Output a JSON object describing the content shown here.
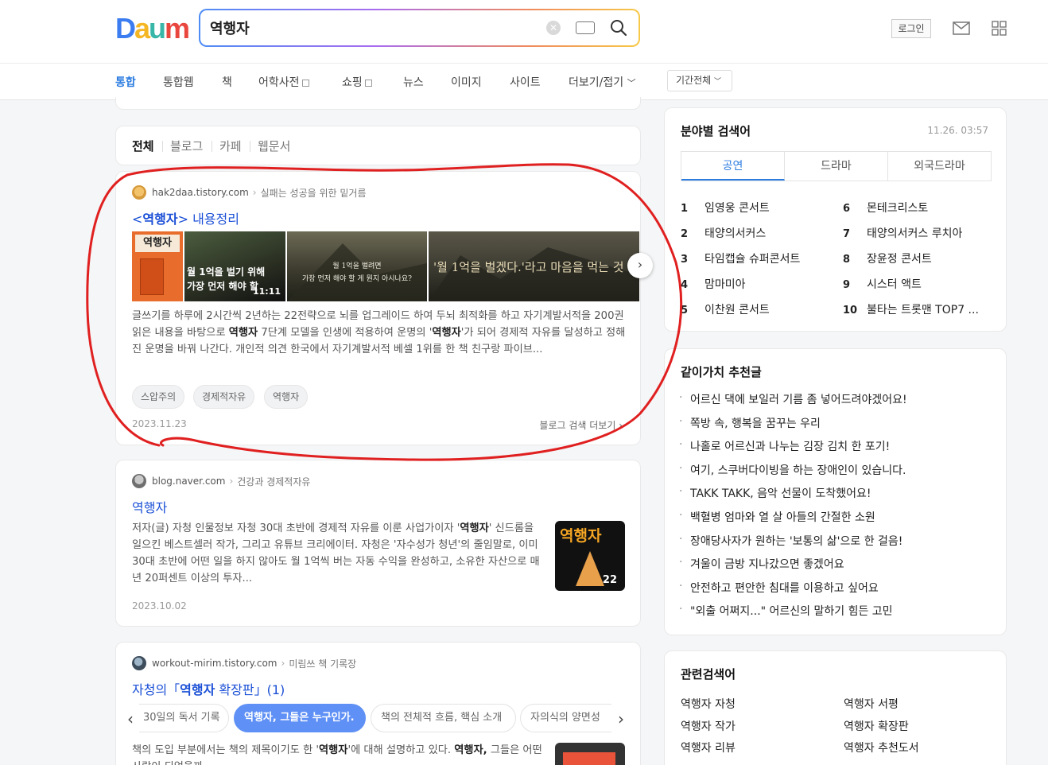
{
  "header": {
    "logo": "Daum",
    "search_value": "역행자",
    "login_label": "로그인"
  },
  "nav": {
    "items": [
      "통합",
      "통합웹",
      "책",
      "어학사전",
      "쇼핑",
      "뉴스",
      "이미지",
      "사이트",
      "더보기/접기"
    ],
    "period": "기간전체"
  },
  "filter_tabs": [
    "전체",
    "블로그",
    "카페",
    "웹문서"
  ],
  "results": [
    {
      "domain": "hak2daa.tistory.com",
      "blog_name": "실패는 성공을 위한 밑거름",
      "title_pre": "<",
      "title_em": "역행자",
      "title_post": "> 내용정리",
      "thumbs": [
        {
          "text": "역행자"
        },
        {
          "text1": "월 1억을 벌기 위해",
          "text2": "가장 먼저 해야 할",
          "duration": "11:11"
        },
        {
          "text1": "월 1억을 벌려면",
          "text2": "가장 먼저 해야 할 게 뭔지 아시나요?"
        },
        {
          "text1": "'월 1억을 벌겠다.'라고 마음을 먹는 것"
        }
      ],
      "snippet_1": "글쓰기를 하루에 2시간씩 2년하는 22전략으로 뇌를 업그레이드 하여 두뇌 최적화를 하고 자기계발서적을 200권 읽은 내용을 바탕으로 ",
      "snippet_em1": "역행자",
      "snippet_2": " 7단계 모델을 인생에 적용하여 운명의 '",
      "snippet_em2": "역행자",
      "snippet_3": "'가 되어 경제적 자유를 달성하고 정해진 운명을 바꿔 나간다. 개인적 의견 한국에서 자기계발서적 베셀 1위를 한 책 친구랑 파이브...",
      "tags": [
        "스압주의",
        "경제적자유",
        "역행자"
      ],
      "date": "2023.11.23",
      "more": "블로그 검색 더보기 ›"
    },
    {
      "domain": "blog.naver.com",
      "blog_name": "건강과 경제적자유",
      "title": "역행자",
      "snippet_1": "저자(글) 자청 인물정보 자청 30대 초반에 경제적 자유를 이룬 사업가이자 '",
      "snippet_em1": "역행자",
      "snippet_2": "' 신드롬을 일으킨 베스트셀러 작가, 그리고 유튜브 크리에이터. 자청은 '자수성가 청년'의 줄임말로, 이미 30대 초반에 어떤 일을 하지 않아도 월 1억씩 버는 자동 수익을 완성하고, 소유한 자산으로 매년 20퍼센트 이상의 투자...",
      "thumb_text": "역행자",
      "thumb_num": "22",
      "date": "2023.10.02"
    },
    {
      "domain": "workout-mirim.tistory.com",
      "blog_name": "미림쓰 책 기록장",
      "title_pre": "자청의「",
      "title_em": "역행자",
      "title_post": " 확장판」(1)",
      "chips": [
        "30일의 독서 기록",
        "역행자, 그들은 누구인가.",
        "책의 전체적 흐름, 핵심 소개",
        "자의식의 양면성"
      ],
      "snippet_1": "책의 도입 부분에서는 책의 제목이기도 한 '",
      "snippet_em1": "역행자",
      "snippet_2": "'에 대해 설명하고 있다. ",
      "snippet_em2": "역행자,",
      "snippet_3": "그들은 어떤 사람이 되었을까..."
    }
  ],
  "ranking": {
    "title": "분야별 검색어",
    "time": "11.26. 03:57",
    "tabs": [
      "공연",
      "드라마",
      "외국드라마"
    ],
    "items": [
      {
        "rank": "1",
        "label": "임영웅 콘서트"
      },
      {
        "rank": "2",
        "label": "태양의서커스"
      },
      {
        "rank": "3",
        "label": "타임캡슐 슈퍼콘서트"
      },
      {
        "rank": "4",
        "label": "맘마미아"
      },
      {
        "rank": "5",
        "label": "이찬원 콘서트"
      },
      {
        "rank": "6",
        "label": "몬테크리스토"
      },
      {
        "rank": "7",
        "label": "태양의서커스 루치아"
      },
      {
        "rank": "8",
        "label": "장윤정 콘서트"
      },
      {
        "rank": "9",
        "label": "시스터 액트"
      },
      {
        "rank": "10",
        "label": "불타는 트롯맨 TOP7 ..."
      }
    ]
  },
  "values": {
    "title": "같이가치 추천글",
    "items": [
      "어르신 댁에 보일러 기름 좀 넣어드려야겠어요!",
      "쪽방 속, 행복을 꿈꾸는 우리",
      "나홀로 어르신과 나누는 김장 김치 한 포기!",
      "여기, 스쿠버다이빙을 하는 장애인이 있습니다.",
      "TAKK TAKK, 음악 선물이 도착했어요!",
      "백혈병 엄마와 열 살 아들의 간절한 소원",
      "장애당사자가 원하는 '보통의 삶'으로 한 걸음!",
      "겨울이 금방 지나갔으면 좋겠어요",
      "안전하고 편안한 침대를 이용하고 싶어요",
      "\"외출 어쩌지...\" 어르신의 말하기 힘든 고민"
    ]
  },
  "related": {
    "title": "관련검색어",
    "items": [
      "역행자 자청",
      "역행자 서평",
      "역행자 작가",
      "역행자 확장판",
      "역행자 리뷰",
      "역행자 추천도서"
    ]
  },
  "colors": {
    "accent": "#2c7ce0",
    "link": "#1a4fd6",
    "annotation": "#e02020"
  }
}
